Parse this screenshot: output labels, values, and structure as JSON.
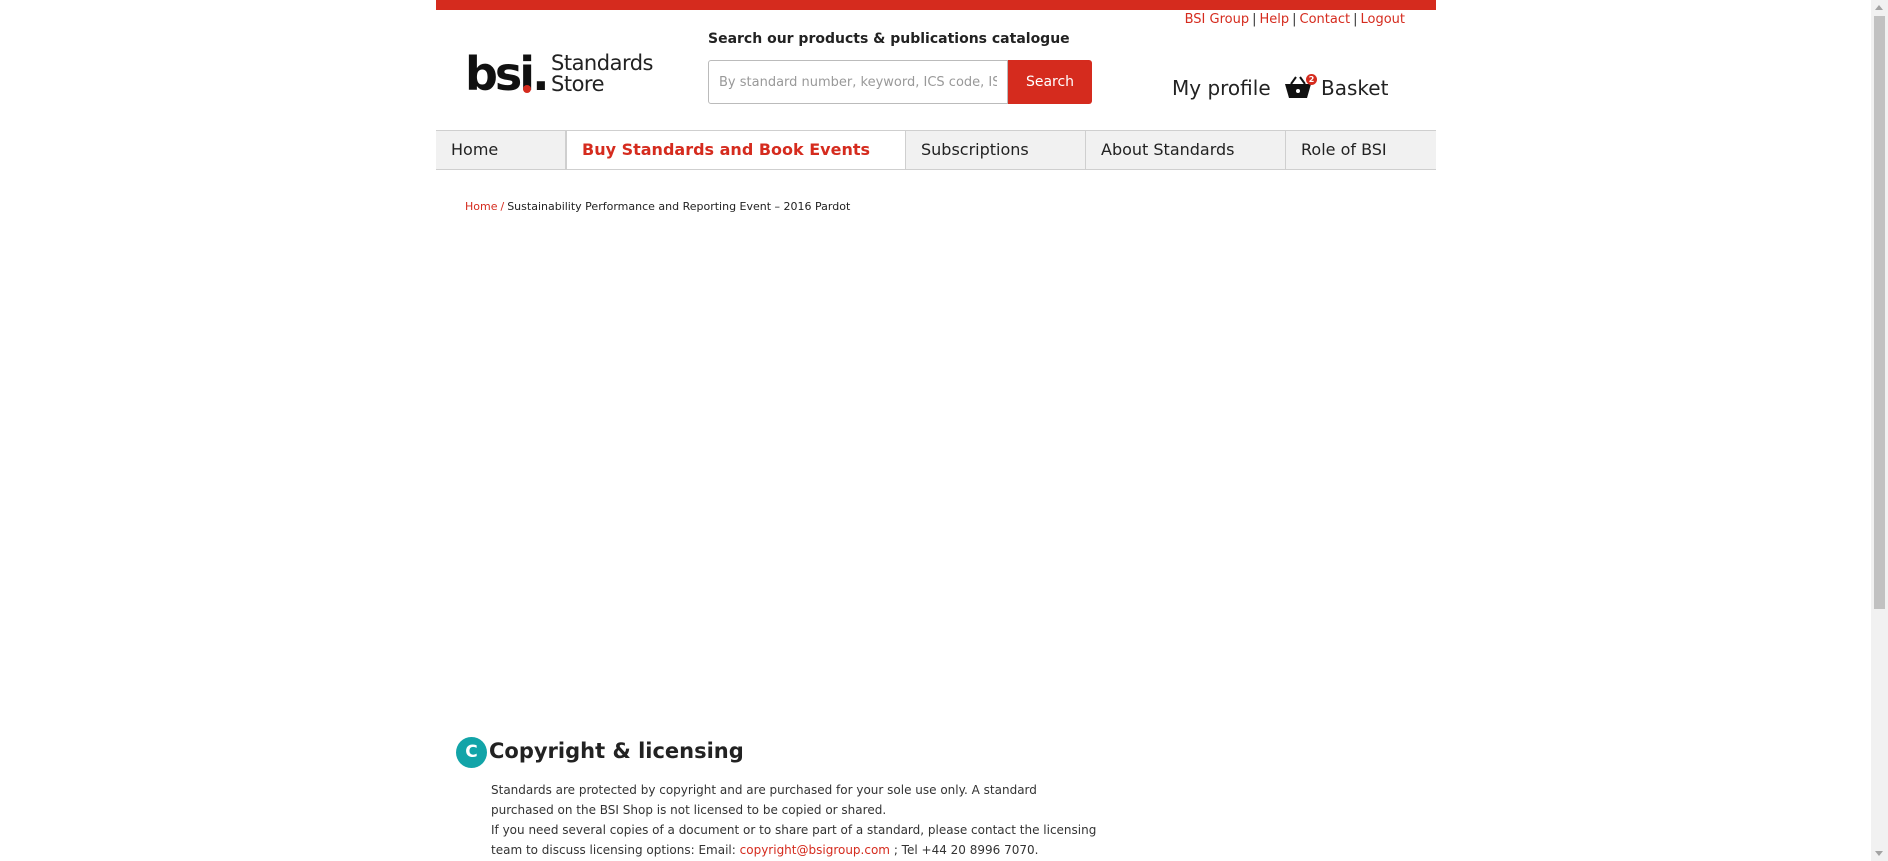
{
  "brand": {
    "logo_text": "bsi.",
    "store_line1": "Standards",
    "store_line2": "Store",
    "accent_color": "#d52b1e",
    "teal_color": "#12a4a8"
  },
  "utility_nav": {
    "links": [
      "BSI Group",
      "Help",
      "Contact",
      "Logout"
    ]
  },
  "search": {
    "label": "Search our products & publications catalogue",
    "placeholder": "By standard number, keyword, ICS code, ISBN",
    "button_label": "Search"
  },
  "account": {
    "profile_label": "My profile",
    "basket_label": "Basket",
    "basket_count": "2"
  },
  "main_nav": {
    "items": [
      {
        "label": "Home"
      },
      {
        "label": "Buy Standards and Book Events",
        "active": true
      },
      {
        "label": "Subscriptions"
      },
      {
        "label": "About Standards"
      },
      {
        "label": "Role of BSI"
      }
    ]
  },
  "breadcrumb": {
    "home": "Home",
    "current": "Sustainability Performance and Reporting Event – 2016 Pardot"
  },
  "copyright": {
    "badge": "C",
    "title": "Copyright & licensing",
    "para1": "Standards are protected by copyright and are purchased for your sole use only. A standard purchased on the BSI Shop is not licensed to be copied or shared.",
    "para2_prefix": "If you need several copies of a document or to share part of a standard, please contact the licensing team to discuss licensing options: Email:",
    "email": "copyright@bsigroup.com",
    "para2_suffix": "; Tel +44 20 8996 7070."
  }
}
